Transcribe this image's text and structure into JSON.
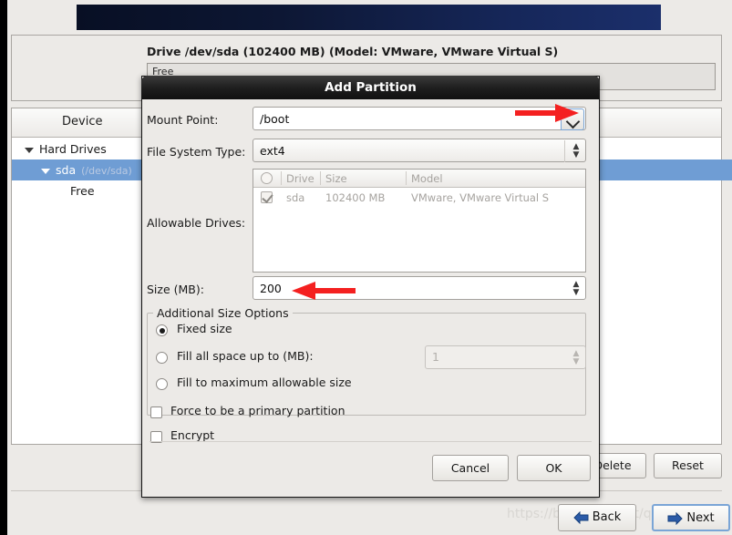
{
  "installer": {
    "drive_info": "Drive /dev/sda (102400 MB) (Model: VMware, VMware Virtual S)",
    "partition_bar_label": "Free",
    "tree_header": "Device",
    "tree": [
      {
        "label": "Hard Drives",
        "detail": "",
        "selected": false
      },
      {
        "label": "sda",
        "detail": "(/dev/sda)",
        "selected": true
      },
      {
        "label": "Free",
        "detail": "",
        "selected": false
      }
    ],
    "buttons": {
      "delete": "Delete",
      "reset": "Reset",
      "back": "Back",
      "next": "Next"
    },
    "watermark": "https://blog.csdn.net/qq_44345340"
  },
  "dialog": {
    "title": "Add Partition",
    "mount_point": {
      "label": "Mount Point:",
      "value": "/boot",
      "dropdown_icon": "chevron-down-icon"
    },
    "file_system_type": {
      "label": "File System Type:",
      "value": "ext4",
      "spinner_icon": "updown-arrows-icon"
    },
    "allowable_drives": {
      "label": "Allowable Drives:",
      "columns": [
        "",
        "Drive",
        "Size",
        "Model"
      ],
      "rows": [
        {
          "checked": true,
          "drive": "sda",
          "size": "102400 MB",
          "model": "VMware, VMware Virtual S"
        }
      ]
    },
    "size": {
      "label": "Size (MB):",
      "value": "200",
      "spinner_icon": "updown-arrows-icon"
    },
    "additional_size_options": {
      "title": "Additional Size Options",
      "options": [
        {
          "label": "Fixed size",
          "selected": true
        },
        {
          "label": "Fill all space up to (MB):",
          "selected": false
        },
        {
          "label": "Fill to maximum allowable size",
          "selected": false
        }
      ],
      "fill_up_to_value": "1"
    },
    "checkboxes": [
      {
        "label": "Force to be a primary partition",
        "checked": false
      },
      {
        "label": "Encrypt",
        "checked": false
      }
    ],
    "buttons": {
      "cancel": "Cancel",
      "ok": "OK"
    }
  },
  "annotations": {
    "arrow_color": "#f42020",
    "arrow_mount_point": "points-to-mount-point-dropdown",
    "arrow_size": "points-to-size-field"
  }
}
